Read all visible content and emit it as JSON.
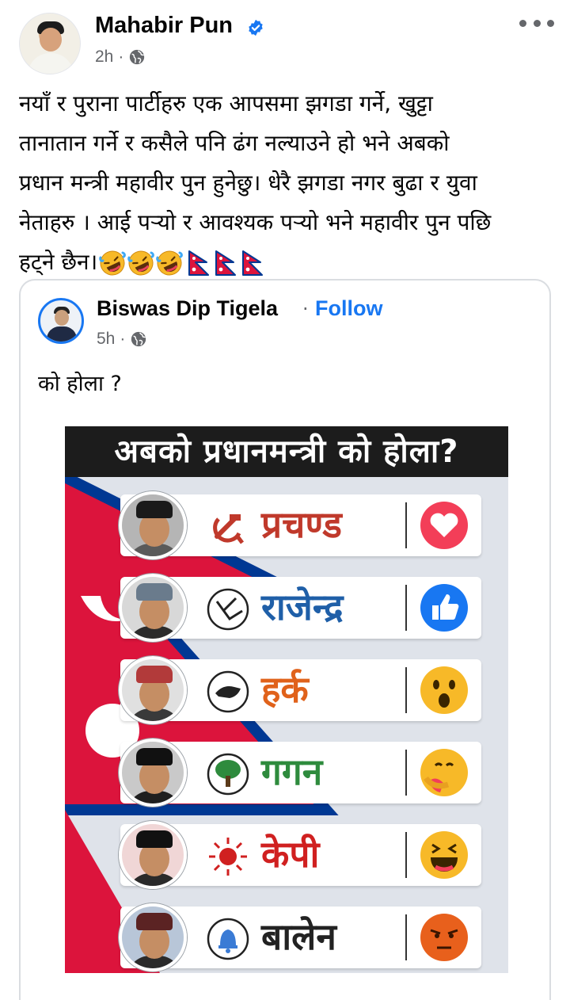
{
  "post": {
    "author": "Mahabir Pun",
    "time": "2h",
    "separator": "·",
    "lines": [
      "नयाँ र पुराना पार्टीहरु एक आपसमा झगडा गर्ने,  खुट्टा",
      "तानातान गर्ने र कसैले पनि ढंग नल्याउने हो भने अबको",
      "प्रधान मन्त्री महावीर पुन हुनेछु। धेरै झगडा नगर बुढा र युवा",
      "नेताहरु । आई पऱ्यो र आवश्यक पऱ्यो भने महावीर पुन पछि",
      "हट्ने छैन।"
    ],
    "emojis": [
      "rolling-laughing-icon",
      "rolling-laughing-icon",
      "rolling-laughing-icon",
      "nepal-flag-icon",
      "nepal-flag-icon",
      "nepal-flag-icon"
    ]
  },
  "shared": {
    "author": "Biswas Dip Tigela",
    "separator": "·",
    "follow_label": "Follow",
    "time": "5h",
    "text": "को होला ?"
  },
  "poster": {
    "title": "अबको प्रधानमन्त्री को होला?",
    "rows": [
      {
        "name": "प्रचण्ड",
        "symbol": "hammer-sickle-icon",
        "reaction": "love-reaction-icon",
        "name_color": "#c0392b"
      },
      {
        "name": "राजेन्द्र",
        "symbol": "plough-icon",
        "reaction": "like-reaction-icon",
        "name_color": "#1f5fa8"
      },
      {
        "name": "हर्क",
        "symbol": "hand-icon",
        "reaction": "wow-reaction-icon",
        "name_color": "#e0621b"
      },
      {
        "name": "गगन",
        "symbol": "tree-icon",
        "reaction": "care-reaction-icon",
        "name_color": "#2e8b3d"
      },
      {
        "name": "केपी",
        "symbol": "sun-icon",
        "reaction": "haha-reaction-icon",
        "name_color": "#d02020"
      },
      {
        "name": "बालेन",
        "symbol": "bell-icon",
        "reaction": "angry-reaction-icon",
        "name_color": "#222222"
      }
    ]
  },
  "colors": {
    "facebook_blue": "#1877f2",
    "secondary_text": "#65676b",
    "nepal_red": "#dc143c",
    "nepal_blue": "#003893"
  }
}
